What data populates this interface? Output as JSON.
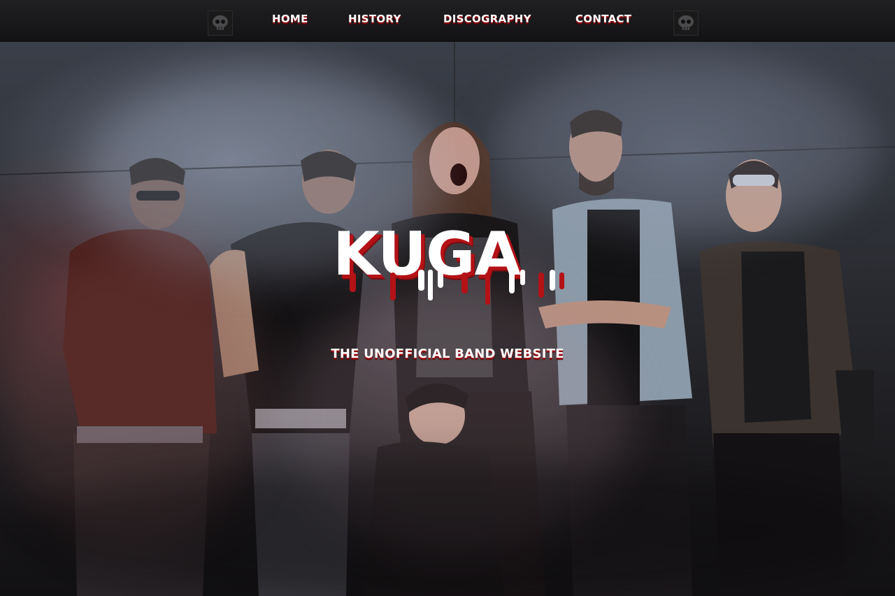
{
  "nav": {
    "logo_left_icon": "skull-logo-icon",
    "logo_right_icon": "skull-logo-icon",
    "items": [
      {
        "label": "HOME"
      },
      {
        "label": "HISTORY"
      },
      {
        "label": "DISCOGRAPHY"
      },
      {
        "label": "CONTACT"
      }
    ]
  },
  "hero": {
    "title": "KUGA",
    "subtitle": "THE UNOFFICIAL BAND WEBSITE",
    "photo_icon": "band-photo"
  },
  "colors": {
    "accent": "#b31217",
    "nav_bg": "#161618",
    "text": "#ffffff"
  }
}
